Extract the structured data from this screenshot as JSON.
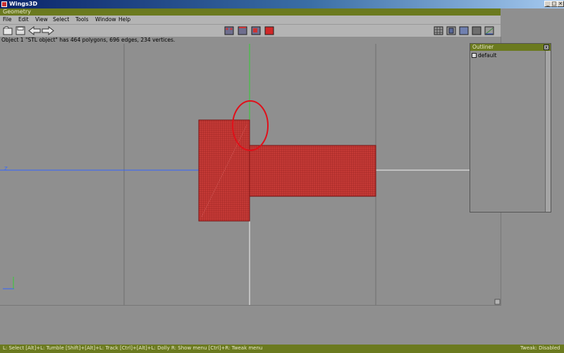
{
  "app": {
    "title": "Wings3D"
  },
  "geometry_window": {
    "title": "Geometry"
  },
  "menu": [
    "File",
    "Edit",
    "View",
    "Select",
    "Tools",
    "Window",
    "Help"
  ],
  "toolbar": {
    "left_icons": [
      "folder-open-icon",
      "save-icon",
      "undo-arrow-icon",
      "redo-arrow-icon"
    ],
    "select_mode_icons": [
      "vertex-select-icon",
      "edge-select-icon",
      "face-select-icon",
      "body-select-icon"
    ],
    "view_icons": [
      "wireframe-icon",
      "smooth-icon",
      "cube-shaded-icon",
      "grid-icon",
      "axes-icon"
    ]
  },
  "info": {
    "text": "Object 1 \"STL object\" has 464 polygons, 696 edges, 234 vertices."
  },
  "viewport": {
    "axis_label": "Z"
  },
  "outliner": {
    "title": "Outliner",
    "close_label": "x",
    "items": [
      "default"
    ]
  },
  "statusbar": {
    "hints": "L: Select  [Alt]+L: Tumble  [Shift]+[Alt]+L: Track  [Ctrl]+[Alt]+L: Dolly  R: Show menu  [Ctrl]+R: Tweak menu",
    "tweak": "Tweak: Disabled"
  },
  "colors": {
    "model_red": "#c43a36",
    "annotation_circle": "#e0101a",
    "title_olive": "#6b7a1f"
  }
}
